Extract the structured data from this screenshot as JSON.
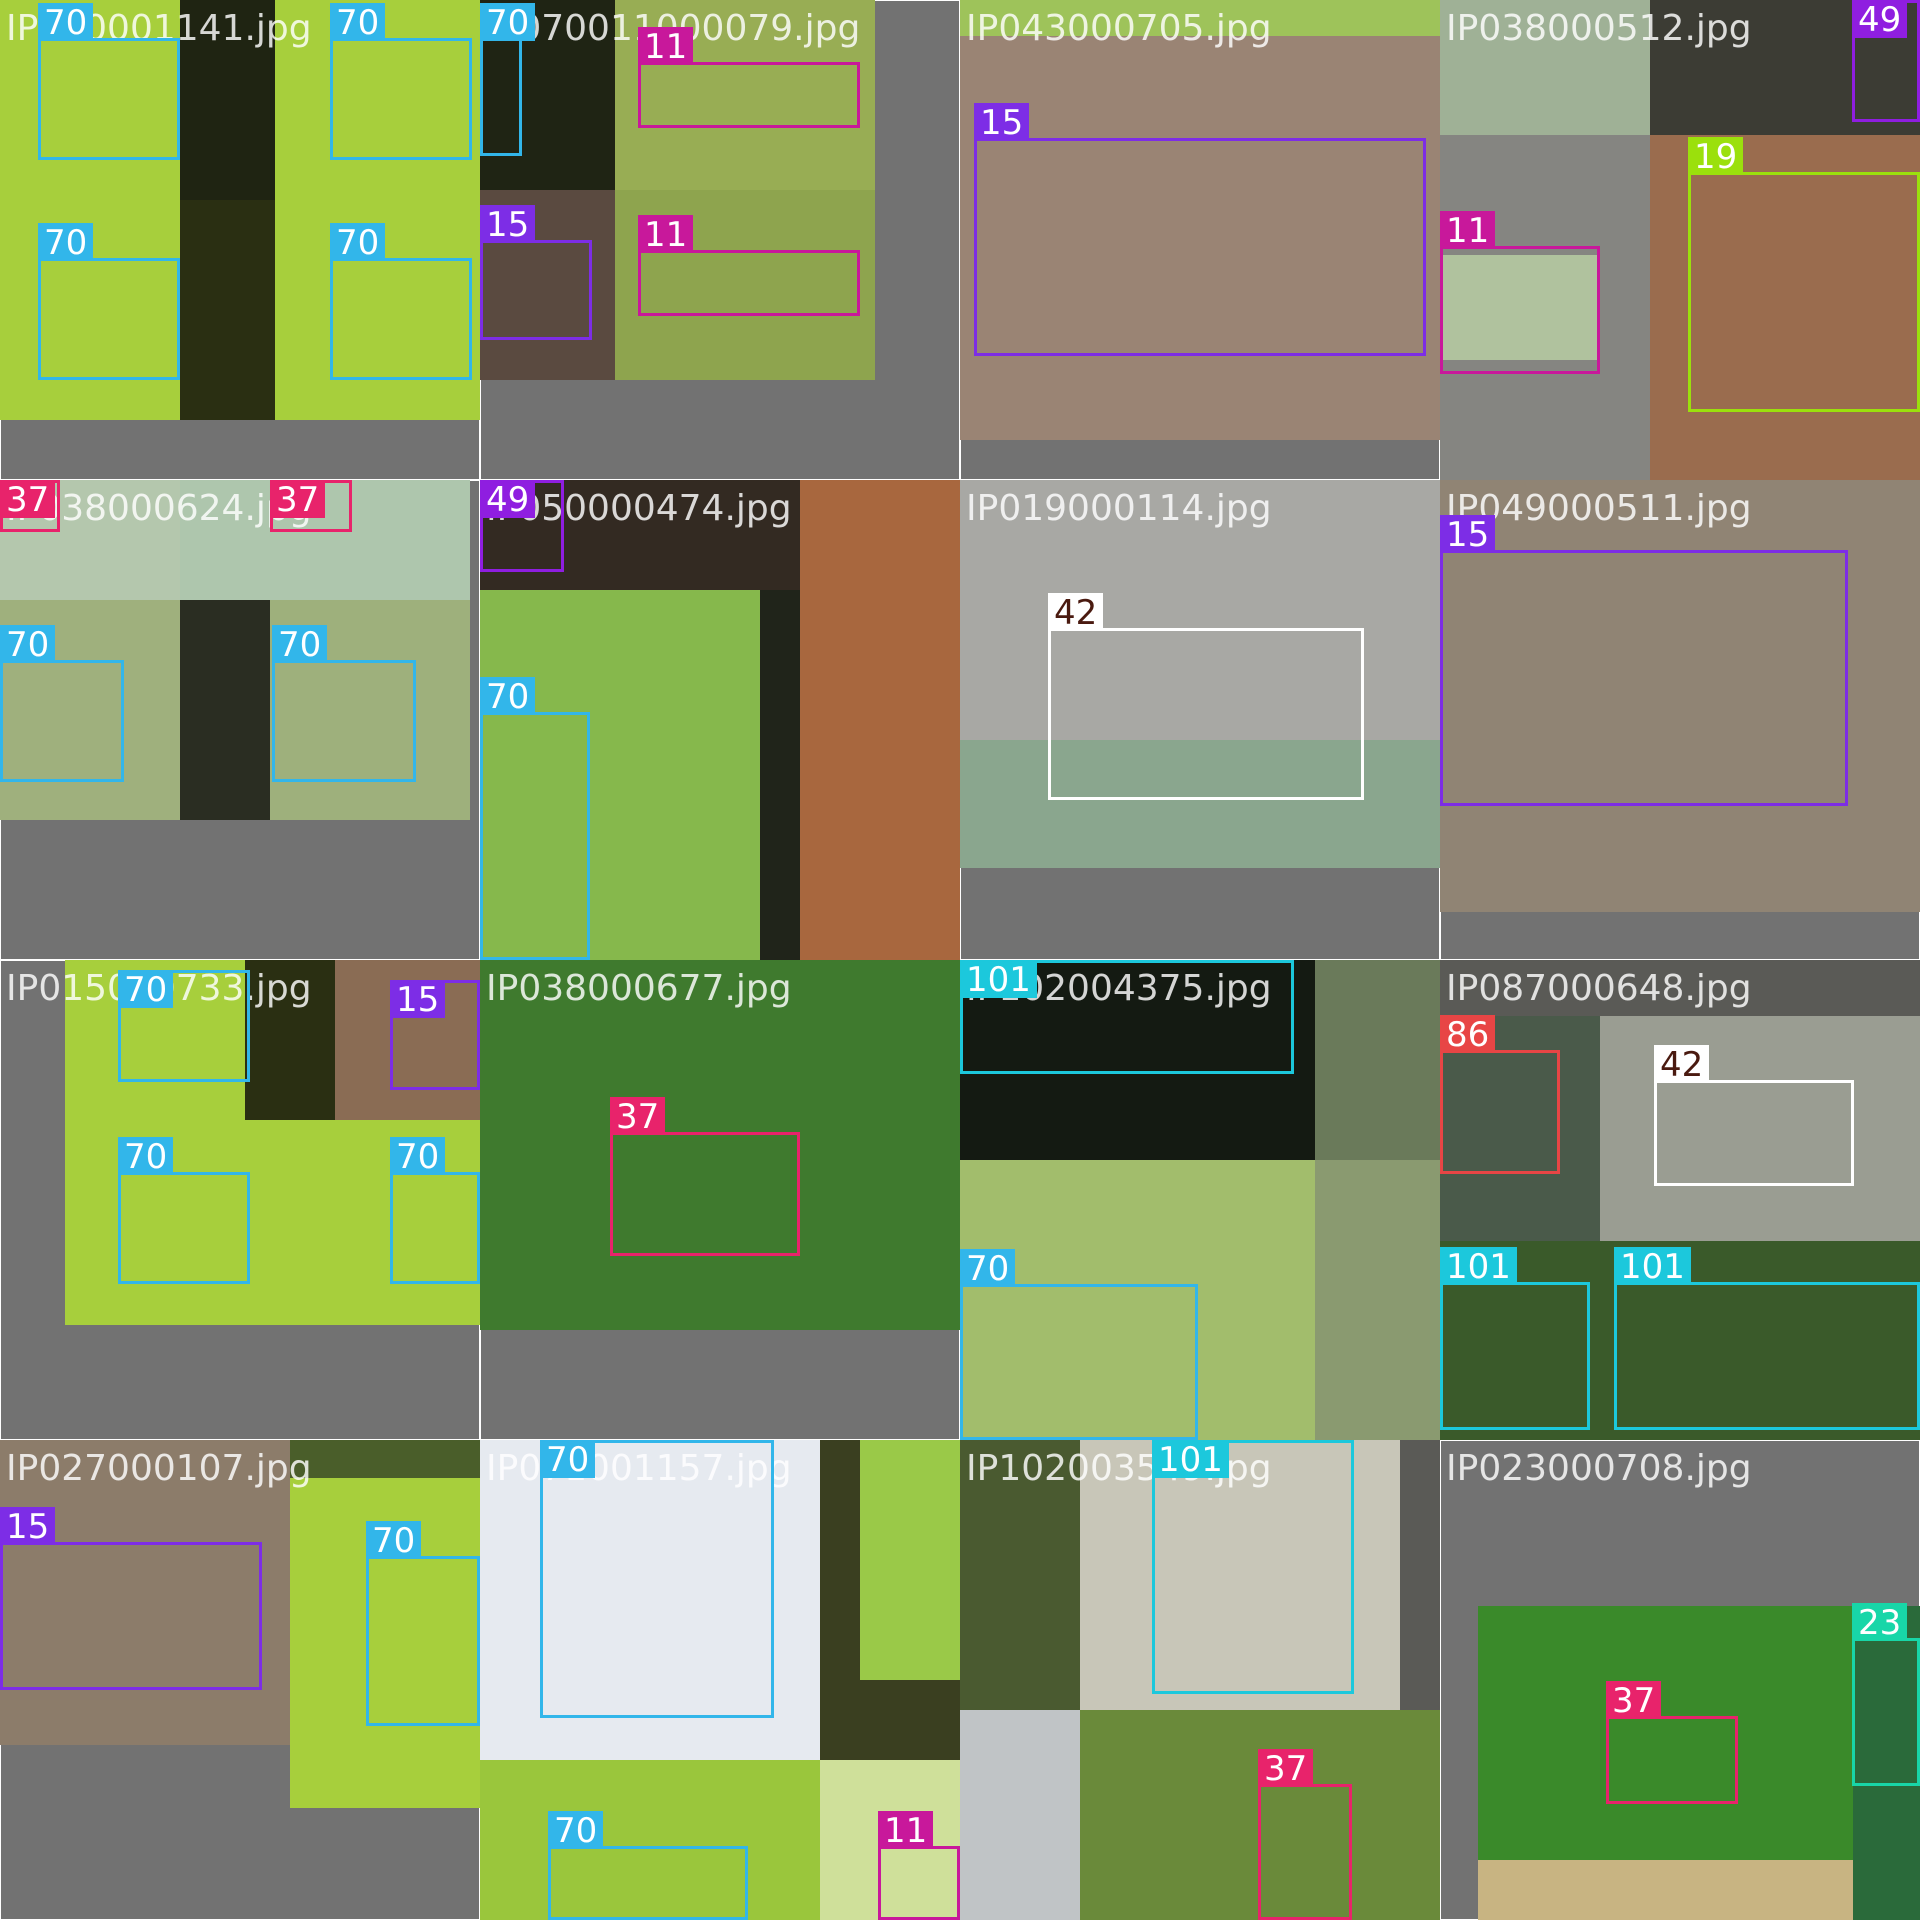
{
  "classes": {
    "11": "#c8189b",
    "15": "#7d2de6",
    "19": "#9be00c",
    "23": "#18d6a8",
    "37": "#e8236b",
    "42": "#ffffff",
    "49": "#8f1ee0",
    "70": "#32b6ea",
    "86": "#e84545",
    "101": "#1cc8dc"
  },
  "tiles": [
    {
      "filename": "IP070001141.jpg",
      "photos": [
        {
          "l": 0,
          "t": 0,
          "w": 275,
          "h": 210,
          "c": "#a7cf3c"
        },
        {
          "l": 180,
          "t": 0,
          "w": 95,
          "h": 200,
          "c": "#1f2412"
        },
        {
          "l": 275,
          "t": 0,
          "w": 205,
          "h": 210,
          "c": "#a7cf3c"
        },
        {
          "l": 0,
          "t": 210,
          "w": 275,
          "h": 210,
          "c": "#a7cf3c"
        },
        {
          "l": 180,
          "t": 200,
          "w": 95,
          "h": 220,
          "c": "#2a2f12"
        },
        {
          "l": 275,
          "t": 210,
          "w": 205,
          "h": 210,
          "c": "#a7cf3c"
        }
      ],
      "boxes": [
        {
          "cls": "70",
          "l": 38,
          "t": 38,
          "w": 142,
          "h": 122
        },
        {
          "cls": "70",
          "l": 330,
          "t": 38,
          "w": 142,
          "h": 122
        },
        {
          "cls": "70",
          "l": 38,
          "t": 258,
          "w": 142,
          "h": 122
        },
        {
          "cls": "70",
          "l": 330,
          "t": 258,
          "w": 142,
          "h": 122
        }
      ]
    },
    {
      "filename": "IP070011000079.jpg",
      "photos": [
        {
          "l": 0,
          "t": 0,
          "w": 135,
          "h": 190,
          "c": "#1f2414"
        },
        {
          "l": 135,
          "t": 0,
          "w": 260,
          "h": 190,
          "c": "#98ad54"
        },
        {
          "l": 0,
          "t": 190,
          "w": 135,
          "h": 190,
          "c": "#5a4a40"
        },
        {
          "l": 135,
          "t": 190,
          "w": 260,
          "h": 190,
          "c": "#8ea44e"
        }
      ],
      "boxes": [
        {
          "cls": "70",
          "l": 0,
          "t": 38,
          "w": 42,
          "h": 118
        },
        {
          "cls": "11",
          "l": 158,
          "t": 62,
          "w": 222,
          "h": 66
        },
        {
          "cls": "15",
          "l": 0,
          "t": 240,
          "w": 112,
          "h": 100
        },
        {
          "cls": "11",
          "l": 158,
          "t": 250,
          "w": 222,
          "h": 66
        }
      ]
    },
    {
      "filename": "IP043000705.jpg",
      "photos": [
        {
          "l": 0,
          "t": 0,
          "w": 480,
          "h": 440,
          "c": "#9a8474"
        },
        {
          "l": 0,
          "t": 0,
          "w": 480,
          "h": 36,
          "c": "#9ec35a"
        }
      ],
      "boxes": [
        {
          "cls": "15",
          "l": 14,
          "t": 138,
          "w": 452,
          "h": 218
        }
      ]
    },
    {
      "filename": "IP038000512.jpg",
      "photos": [
        {
          "l": 0,
          "t": 0,
          "w": 210,
          "h": 135,
          "c": "#9fb196"
        },
        {
          "l": 210,
          "t": 0,
          "w": 270,
          "h": 135,
          "c": "#3c3c34"
        },
        {
          "l": 0,
          "t": 135,
          "w": 210,
          "h": 345,
          "c": "#858581"
        },
        {
          "l": 0,
          "t": 255,
          "w": 160,
          "h": 105,
          "c": "#b0c29e"
        },
        {
          "l": 210,
          "t": 135,
          "w": 270,
          "h": 345,
          "c": "#9a6c4e"
        }
      ],
      "boxes": [
        {
          "cls": "49",
          "l": 412,
          "t": 0,
          "w": 68,
          "h": 122
        },
        {
          "cls": "19",
          "l": 248,
          "t": 172,
          "w": 232,
          "h": 240
        },
        {
          "cls": "11",
          "l": 0,
          "t": 246,
          "w": 160,
          "h": 128
        }
      ]
    },
    {
      "filename": "IP038000624.jpg",
      "photos": [
        {
          "l": 0,
          "t": 0,
          "w": 180,
          "h": 120,
          "c": "#b4c7ad"
        },
        {
          "l": 180,
          "t": 0,
          "w": 290,
          "h": 120,
          "c": "#aec6ad"
        },
        {
          "l": 0,
          "t": 120,
          "w": 180,
          "h": 220,
          "c": "#9fb07d"
        },
        {
          "l": 180,
          "t": 120,
          "w": 290,
          "h": 220,
          "c": "#9eb07c"
        },
        {
          "l": 180,
          "t": 120,
          "w": 90,
          "h": 220,
          "c": "#2a2d22"
        }
      ],
      "boxes": [
        {
          "cls": "37",
          "l": 0,
          "t": 0,
          "w": 60,
          "h": 52
        },
        {
          "cls": "37",
          "l": 270,
          "t": 0,
          "w": 82,
          "h": 52
        },
        {
          "cls": "70",
          "l": 0,
          "t": 180,
          "w": 124,
          "h": 122
        },
        {
          "cls": "70",
          "l": 272,
          "t": 180,
          "w": 144,
          "h": 122
        }
      ]
    },
    {
      "filename": "IP050000474.jpg",
      "photos": [
        {
          "l": 0,
          "t": 0,
          "w": 320,
          "h": 110,
          "c": "#332a22"
        },
        {
          "l": 320,
          "t": 0,
          "w": 160,
          "h": 480,
          "c": "#a8673e"
        },
        {
          "l": 0,
          "t": 110,
          "w": 320,
          "h": 370,
          "c": "#86b84c"
        },
        {
          "l": 280,
          "t": 110,
          "w": 40,
          "h": 370,
          "c": "#20241a"
        }
      ],
      "boxes": [
        {
          "cls": "49",
          "l": 0,
          "t": 0,
          "w": 84,
          "h": 92
        },
        {
          "cls": "70",
          "l": 0,
          "t": 232,
          "w": 110,
          "h": 248
        }
      ]
    },
    {
      "filename": "IP019000114.jpg",
      "photos": [
        {
          "l": 0,
          "t": 0,
          "w": 480,
          "h": 388,
          "c": "#a8a8a4"
        },
        {
          "l": 0,
          "t": 260,
          "w": 480,
          "h": 128,
          "c": "#8aa68e"
        }
      ],
      "boxes": [
        {
          "cls": "42",
          "l": 88,
          "t": 148,
          "w": 316,
          "h": 172
        }
      ]
    },
    {
      "filename": "IP049000511.jpg",
      "photos": [
        {
          "l": 0,
          "t": 0,
          "w": 480,
          "h": 432,
          "c": "#908474"
        }
      ],
      "boxes": [
        {
          "cls": "15",
          "l": 0,
          "t": 70,
          "w": 408,
          "h": 256
        }
      ]
    },
    {
      "filename": "IP015000733.jpg",
      "photos": [
        {
          "l": 65,
          "t": 0,
          "w": 270,
          "h": 160,
          "c": "#a7cf3c"
        },
        {
          "l": 245,
          "t": 0,
          "w": 90,
          "h": 160,
          "c": "#2a2f12"
        },
        {
          "l": 335,
          "t": 0,
          "w": 145,
          "h": 160,
          "c": "#8a6c54"
        },
        {
          "l": 65,
          "t": 160,
          "w": 270,
          "h": 205,
          "c": "#a7cf3c"
        },
        {
          "l": 335,
          "t": 160,
          "w": 145,
          "h": 205,
          "c": "#a7cf3c"
        }
      ],
      "boxes": [
        {
          "cls": "70",
          "l": 118,
          "t": 10,
          "w": 132,
          "h": 112
        },
        {
          "cls": "15",
          "l": 390,
          "t": 20,
          "w": 90,
          "h": 110
        },
        {
          "cls": "70",
          "l": 118,
          "t": 212,
          "w": 132,
          "h": 112
        },
        {
          "cls": "70",
          "l": 390,
          "t": 212,
          "w": 90,
          "h": 112
        }
      ]
    },
    {
      "filename": "IP038000677.jpg",
      "photos": [
        {
          "l": 0,
          "t": 0,
          "w": 480,
          "h": 370,
          "c": "#3f7a2e"
        }
      ],
      "boxes": [
        {
          "cls": "37",
          "l": 130,
          "t": 172,
          "w": 190,
          "h": 124
        }
      ]
    },
    {
      "filename": "IP102004375.jpg",
      "photos": [
        {
          "l": 0,
          "t": 0,
          "w": 355,
          "h": 200,
          "c": "#141a12"
        },
        {
          "l": 355,
          "t": 0,
          "w": 125,
          "h": 200,
          "c": "#6a7a5a"
        },
        {
          "l": 0,
          "t": 200,
          "w": 355,
          "h": 280,
          "c": "#a2bd6c"
        },
        {
          "l": 355,
          "t": 200,
          "w": 125,
          "h": 280,
          "c": "#8a9a70"
        }
      ],
      "boxes": [
        {
          "cls": "101",
          "l": 0,
          "t": 0,
          "w": 334,
          "h": 114
        },
        {
          "cls": "70",
          "l": 0,
          "t": 324,
          "w": 238,
          "h": 156
        }
      ]
    },
    {
      "filename": "IP087000648.jpg",
      "photos": [
        {
          "l": 0,
          "t": 0,
          "w": 480,
          "h": 56,
          "c": "#5a5a56"
        },
        {
          "l": 0,
          "t": 56,
          "w": 160,
          "h": 225,
          "c": "#4a5a4a"
        },
        {
          "l": 160,
          "t": 56,
          "w": 320,
          "h": 225,
          "c": "#9a9d92"
        },
        {
          "l": 0,
          "t": 281,
          "w": 480,
          "h": 199,
          "c": "#3a5a2a"
        }
      ],
      "boxes": [
        {
          "cls": "86",
          "l": 0,
          "t": 90,
          "w": 120,
          "h": 124
        },
        {
          "cls": "42",
          "l": 214,
          "t": 120,
          "w": 200,
          "h": 106
        },
        {
          "cls": "101",
          "l": 0,
          "t": 322,
          "w": 150,
          "h": 148
        },
        {
          "cls": "101",
          "l": 174,
          "t": 322,
          "w": 306,
          "h": 148
        }
      ]
    },
    {
      "filename": "IP027000107.jpg",
      "photos": [
        {
          "l": 0,
          "t": 0,
          "w": 290,
          "h": 305,
          "c": "#8c7c6a"
        },
        {
          "l": 290,
          "t": 0,
          "w": 190,
          "h": 38,
          "c": "#4a5e2a"
        },
        {
          "l": 290,
          "t": 38,
          "w": 190,
          "h": 330,
          "c": "#a7cf3c"
        }
      ],
      "boxes": [
        {
          "cls": "15",
          "l": 0,
          "t": 102,
          "w": 262,
          "h": 148
        },
        {
          "cls": "70",
          "l": 366,
          "t": 116,
          "w": 114,
          "h": 170
        }
      ]
    },
    {
      "filename": "IP071001157.jpg",
      "photos": [
        {
          "l": 0,
          "t": 0,
          "w": 340,
          "h": 320,
          "c": "#e6eaf0"
        },
        {
          "l": 340,
          "t": 0,
          "w": 140,
          "h": 320,
          "c": "#3a3f20"
        },
        {
          "l": 380,
          "t": 0,
          "w": 100,
          "h": 240,
          "c": "#9ac948"
        },
        {
          "l": 0,
          "t": 320,
          "w": 340,
          "h": 160,
          "c": "#9ac63c"
        },
        {
          "l": 340,
          "t": 320,
          "w": 140,
          "h": 160,
          "c": "#cfe09a"
        }
      ],
      "boxes": [
        {
          "cls": "70",
          "l": 60,
          "t": 0,
          "w": 234,
          "h": 278
        },
        {
          "cls": "70",
          "l": 68,
          "t": 406,
          "w": 200,
          "h": 74
        },
        {
          "cls": "11",
          "l": 398,
          "t": 406,
          "w": 82,
          "h": 74
        }
      ]
    },
    {
      "filename": "IP102003549.jpg",
      "photos": [
        {
          "l": 0,
          "t": 0,
          "w": 120,
          "h": 270,
          "c": "#4a5a30"
        },
        {
          "l": 120,
          "t": 0,
          "w": 320,
          "h": 270,
          "c": "#c8c6b8"
        },
        {
          "l": 440,
          "t": 0,
          "w": 40,
          "h": 270,
          "c": "#5a5a56"
        },
        {
          "l": 0,
          "t": 270,
          "w": 120,
          "h": 210,
          "c": "#c0c4c6"
        },
        {
          "l": 120,
          "t": 270,
          "w": 360,
          "h": 210,
          "c": "#6a8a3a"
        }
      ],
      "boxes": [
        {
          "cls": "101",
          "l": 192,
          "t": 0,
          "w": 202,
          "h": 254
        },
        {
          "cls": "37",
          "l": 298,
          "t": 344,
          "w": 94,
          "h": 136
        }
      ]
    },
    {
      "filename": "IP023000708.jpg",
      "photos": [
        {
          "l": 38,
          "t": 166,
          "w": 375,
          "h": 254,
          "c": "#3a8a2a"
        },
        {
          "l": 38,
          "t": 420,
          "w": 375,
          "h": 60,
          "c": "#c8b482"
        },
        {
          "l": 413,
          "t": 166,
          "w": 67,
          "h": 314,
          "c": "#2a6a3a"
        }
      ],
      "boxes": [
        {
          "cls": "37",
          "l": 166,
          "t": 276,
          "w": 132,
          "h": 88
        },
        {
          "cls": "23",
          "l": 412,
          "t": 198,
          "w": 68,
          "h": 148
        }
      ]
    }
  ]
}
